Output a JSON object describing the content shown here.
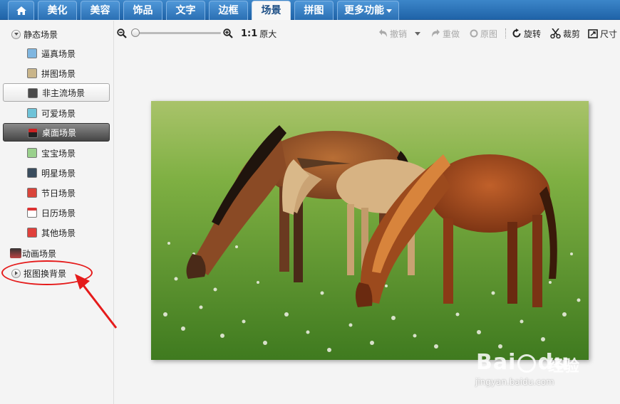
{
  "tabs": [
    {
      "label": "美化"
    },
    {
      "label": "美容"
    },
    {
      "label": "饰品"
    },
    {
      "label": "文字"
    },
    {
      "label": "边框"
    },
    {
      "label": "场景"
    },
    {
      "label": "拼图"
    },
    {
      "label": "更多功能"
    }
  ],
  "sidebar": {
    "group1_label": "静态场景",
    "items": [
      {
        "label": "逼真场景"
      },
      {
        "label": "拼图场景"
      },
      {
        "label": "非主流场景"
      },
      {
        "label": "可爱场景"
      },
      {
        "label": "桌面场景"
      },
      {
        "label": "宝宝场景"
      },
      {
        "label": "明星场景"
      },
      {
        "label": "节日场景"
      },
      {
        "label": "日历场景"
      },
      {
        "label": "其他场景"
      }
    ],
    "group2_label": "动画场景",
    "group3_label": "抠图换背景"
  },
  "toolbar": {
    "zoom_ratio": "1:1",
    "original_size": "原大",
    "undo": "撤销",
    "redo": "重做",
    "original": "原图",
    "rotate": "旋转",
    "crop": "裁剪",
    "size": "尺寸",
    "zoom_level": 0.0
  },
  "watermark": {
    "brand": "Bai",
    "brand2": "du",
    "cn": "经验",
    "url": "jingyan.baidu.com"
  },
  "colors": {
    "tab_bar": "#2a72ba",
    "annotation_red": "#e51b1b",
    "selected_item": "#5a5a5a"
  }
}
